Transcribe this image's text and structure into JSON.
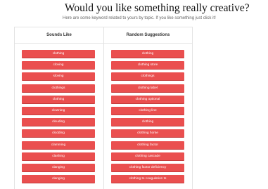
{
  "header": {
    "title": "Would you like something really creative?",
    "subtitle": "Here are some keyword related to yours by topic. If you like something just click it!"
  },
  "sounds_like": {
    "heading": "Sounds Like",
    "items": [
      "clothing",
      "cloving",
      "sloving",
      "clothings",
      "clothing",
      "clowning",
      "clouding",
      "clodding",
      "clamming",
      "clashing",
      "clanging",
      "clanging"
    ]
  },
  "random_suggestions": {
    "heading": "Random Suggestions",
    "items": [
      "clothing",
      "clothing store",
      "clothings",
      "clothing label",
      "clothing optional",
      "clothing line",
      "clothing",
      "clothing horse",
      "clothing factor",
      "clothing cascade",
      "clothing factor deficiency",
      "clothing to coagulation ts"
    ]
  },
  "colors": {
    "button_bg": "#ea4f4f",
    "button_text": "#ffffff"
  }
}
